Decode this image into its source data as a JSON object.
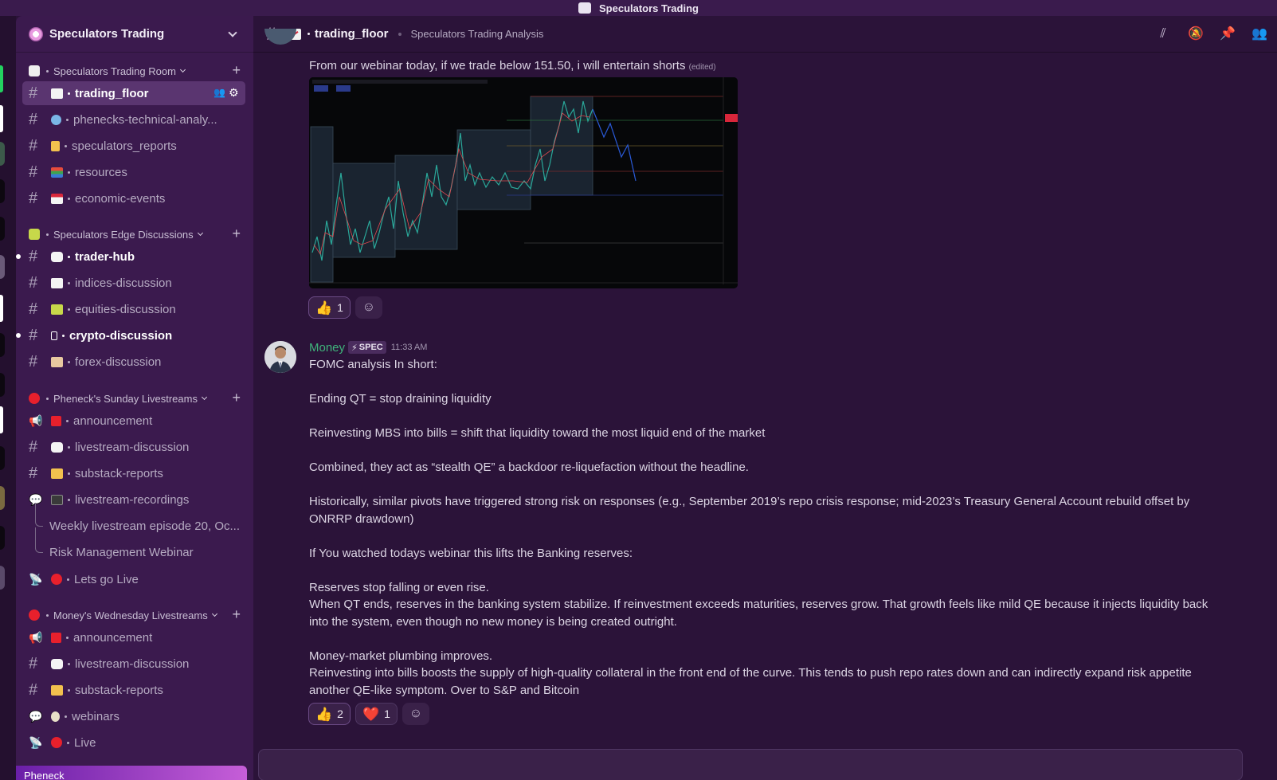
{
  "window": {
    "title": "Speculators Trading"
  },
  "server": {
    "name": "Speculators Trading"
  },
  "sidebar": {
    "categories": [
      {
        "label": "Speculators Trading Room"
      },
      {
        "label": "Speculators Edge Discussions"
      },
      {
        "label": "Pheneck's Sunday Livestreams"
      },
      {
        "label": "Money's Wednesday Livestreams"
      }
    ],
    "channels": [
      {
        "label": "trading_floor"
      },
      {
        "label": "phenecks-technical-analy..."
      },
      {
        "label": "speculators_reports"
      },
      {
        "label": "resources"
      },
      {
        "label": "economic-events"
      },
      {
        "label": "trader-hub"
      },
      {
        "label": "indices-discussion"
      },
      {
        "label": "equities-discussion"
      },
      {
        "label": "crypto-discussion"
      },
      {
        "label": "forex-discussion"
      },
      {
        "label": "announcement"
      },
      {
        "label": "livestream-discussion"
      },
      {
        "label": "substack-reports"
      },
      {
        "label": "livestream-recordings"
      },
      {
        "label": "Lets go Live"
      },
      {
        "label": "announcement"
      },
      {
        "label": "livestream-discussion"
      },
      {
        "label": "substack-reports"
      },
      {
        "label": "webinars"
      },
      {
        "label": "Live"
      }
    ],
    "threads": [
      {
        "label": "Weekly livestream episode 20, Oc..."
      },
      {
        "label": "Risk Management Webinar"
      }
    ]
  },
  "header": {
    "channel_name": "trading_floor",
    "topic": "Speculators Trading Analysis"
  },
  "messages": [
    {
      "text": "From our webinar today, if we trade below 151.50, i will entertain shorts",
      "edited": "(edited)",
      "reactions": [
        {
          "emoji": "👍",
          "count": "1"
        }
      ]
    },
    {
      "author": "Money",
      "role": "SPEC",
      "time": "11:33 AM",
      "paragraphs": [
        "FOMC analysis In short:",
        "Ending QT = stop draining liquidity",
        "Reinvesting MBS into bills = shift that liquidity toward the most liquid end of the market",
        "Combined, they act as “stealth QE”  a backdoor re-liquefaction without the headline.",
        "Historically, similar pivots have triggered strong risk on responses (e.g., September 2019’s repo crisis response; mid-2023’s Treasury General Account rebuild offset by ONRRP drawdown)",
        "If You watched todays webinar this lifts the Banking reserves:",
        "Reserves stop falling or even rise.\nWhen QT ends, reserves in the banking system stabilize. If reinvestment exceeds maturities, reserves grow. That growth feels like mild QE because it injects liquidity back into the system, even though no new money is being created outright.",
        "Money-market plumbing improves.\nReinvesting into bills boosts the supply of high-quality collateral in the front end of the curve. This tends to push repo rates down and can indirectly expand risk appetite another QE-like symptom. Over to S&P and Bitcoin"
      ],
      "reactions": [
        {
          "emoji": "👍",
          "count": "2"
        },
        {
          "emoji": "❤️",
          "count": "1"
        }
      ]
    }
  ],
  "user_bar": {
    "label": "Pheneck"
  },
  "colors": {
    "sidebar_bg": "#3b1a4e",
    "main_bg": "#2b1339",
    "author_green": "#3fb37b",
    "active_channel": "#5a3570"
  }
}
